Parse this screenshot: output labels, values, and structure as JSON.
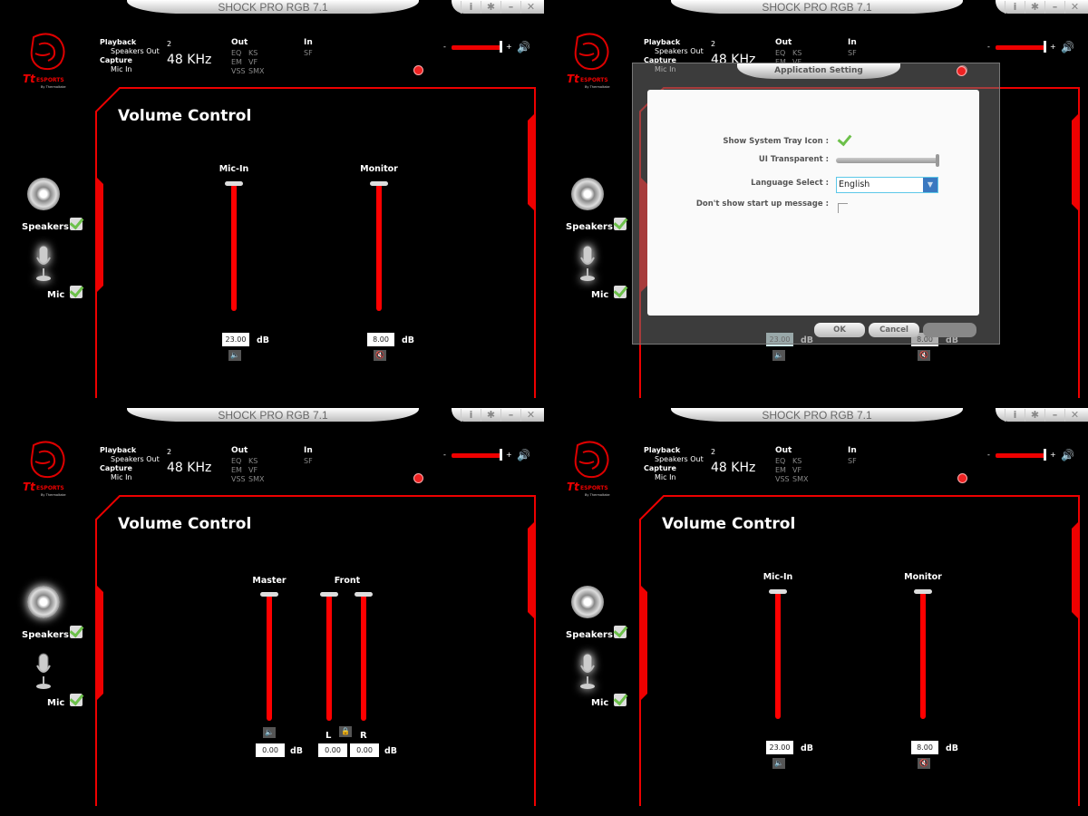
{
  "app_title": "SHOCK PRO RGB 7.1",
  "window_buttons": [
    "i",
    "✱",
    "–",
    "✕"
  ],
  "colors": {
    "accent": "#ff0000",
    "background": "#000000",
    "check": "#6cc04a"
  },
  "header": {
    "playback_label": "Playback",
    "playback_device": "Speakers Out",
    "capture_label": "Capture",
    "capture_device": "Mic In",
    "channels": "2",
    "sample_rate": "48 KHz",
    "out_label": "Out",
    "out_items": [
      "EQ",
      "KS",
      "EM",
      "VF",
      "VSS",
      "SMX"
    ],
    "in_label": "In",
    "in_items": [
      "SF"
    ],
    "master_volume_min": "-",
    "master_volume_max": "+",
    "master_volume_level": 1.0
  },
  "nav": {
    "speakers": "Speakers",
    "mic": "Mic"
  },
  "panel_title": "Volume Control",
  "db_unit": "dB",
  "screens": [
    {
      "selected": "mic",
      "sliders": [
        {
          "label": "Mic-In",
          "value": "23.00",
          "muted": false
        },
        {
          "label": "Monitor",
          "value": "8.00",
          "muted": true
        }
      ]
    },
    {
      "selected": "mic",
      "sliders": [
        {
          "label": "",
          "value": "23.00",
          "muted": false
        },
        {
          "label": "",
          "value": "8.00",
          "muted": true
        }
      ],
      "dialog": {
        "title": "Application Setting",
        "show_tray_label": "Show System Tray Icon :",
        "show_tray_checked": true,
        "ui_transparent_label": "UI Transparent :",
        "ui_transparent_level": 1.0,
        "language_label": "Language Select :",
        "language_value": "English",
        "startup_msg_label": "Don't show start up message :",
        "startup_msg_checked": false,
        "ok": "OK",
        "cancel": "Cancel"
      }
    },
    {
      "selected": "speakers",
      "speaker_panel": {
        "master_label": "Master",
        "master_value": "0.00",
        "front_label": "Front",
        "left_label": "L",
        "right_label": "R",
        "left_value": "0.00",
        "right_value": "0.00"
      }
    },
    {
      "selected": "mic",
      "sliders": [
        {
          "label": "Mic-In",
          "value": "23.00",
          "muted": false
        },
        {
          "label": "Monitor",
          "value": "8.00",
          "muted": true
        }
      ]
    }
  ]
}
